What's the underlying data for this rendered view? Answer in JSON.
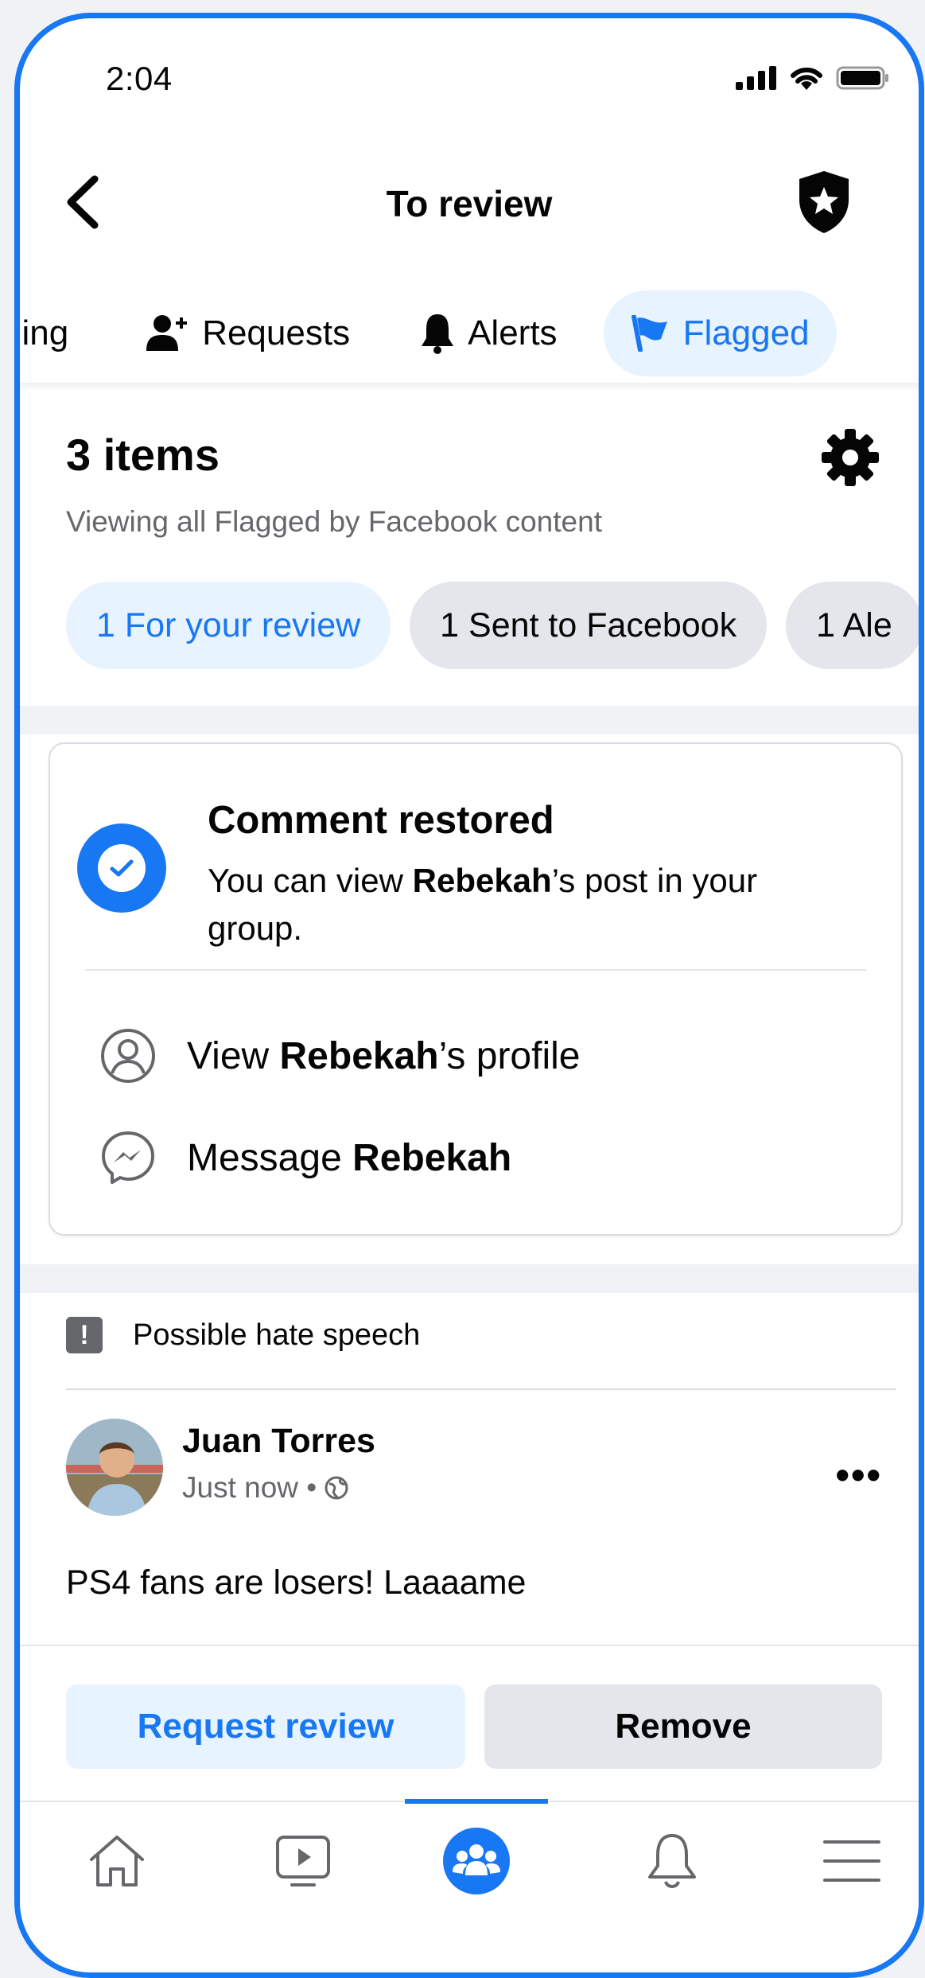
{
  "status_bar": {
    "time": "2:04"
  },
  "header": {
    "title": "To review"
  },
  "tabs": [
    {
      "label": "ding",
      "icon": "none"
    },
    {
      "label": "Requests",
      "icon": "add-person-icon"
    },
    {
      "label": "Alerts",
      "icon": "bell-icon"
    },
    {
      "label": "Flagged",
      "icon": "flag-icon",
      "active": true
    }
  ],
  "items": {
    "title": "3 items",
    "subtitle": "Viewing all Flagged by Facebook content",
    "chips": [
      {
        "label": "1 For your review",
        "active": true
      },
      {
        "label": "1 Sent to Facebook"
      },
      {
        "label": "1 Ale"
      }
    ]
  },
  "notice": {
    "title": "Comment restored",
    "body_pre": "You can view ",
    "body_name": "Rebekah",
    "body_post": "’s post in your group.",
    "profile_pre": "View ",
    "profile_name": "Rebekah",
    "profile_post": "’s profile",
    "message_pre": "Message ",
    "message_name": "Rebekah"
  },
  "flagged_post": {
    "reason": "Possible hate speech",
    "author": "Juan Torres",
    "time": "Just now •",
    "text": "PS4 fans are losers! Laaaame",
    "more": "•••",
    "request_review_label": "Request review",
    "remove_label": "Remove"
  },
  "colors": {
    "accent": "#1877f2",
    "accent_bg": "#e7f3ff",
    "chip_bg": "#e4e6eb",
    "secondary_text": "#65676b"
  }
}
